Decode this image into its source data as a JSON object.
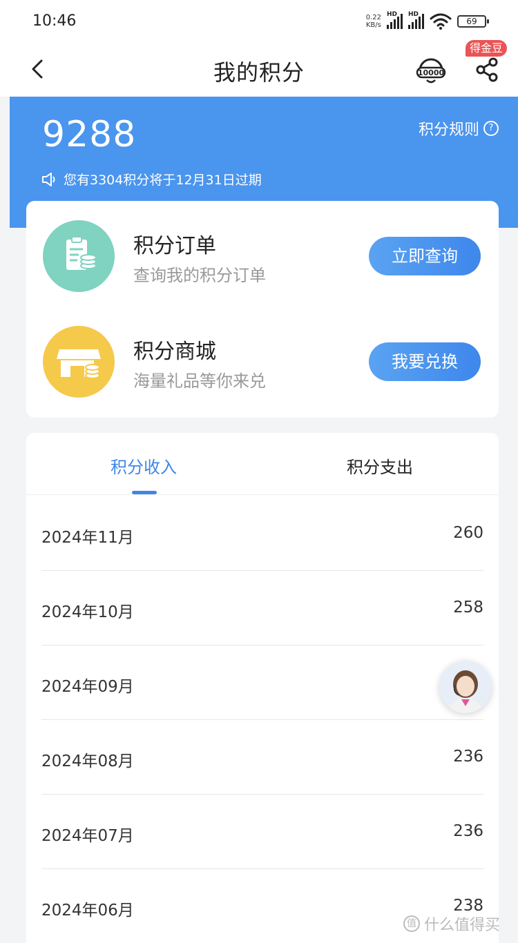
{
  "status_bar": {
    "time": "10:46",
    "net_speed_value": "0.22",
    "net_speed_unit": "KB/s",
    "hd_label_1": "HD",
    "hd_label_2": "HD",
    "battery": "69"
  },
  "header": {
    "title": "我的积分",
    "gold_badge": "得金豆",
    "hotline_label": "10000"
  },
  "banner": {
    "points": "9288",
    "rules_label": "积分规则",
    "expire_notice": "您有3304积分将于12月31日过期"
  },
  "features": [
    {
      "title": "积分订单",
      "subtitle": "查询我的积分订单",
      "button": "立即查询",
      "color": "#7fd3c0"
    },
    {
      "title": "积分商城",
      "subtitle": "海量礼品等你来兑",
      "button": "我要兑换",
      "color": "#f5c94a"
    }
  ],
  "tabs": {
    "income": "积分收入",
    "expense": "积分支出",
    "active": "income"
  },
  "records": [
    {
      "month": "2024年11月",
      "points": "260"
    },
    {
      "month": "2024年10月",
      "points": "258"
    },
    {
      "month": "2024年09月",
      "points": ""
    },
    {
      "month": "2024年08月",
      "points": "236"
    },
    {
      "month": "2024年07月",
      "points": "236"
    },
    {
      "month": "2024年06月",
      "points": "238"
    }
  ],
  "watermark": "什么值得买",
  "colors": {
    "accent": "#3d86e6",
    "banner": "#4a95ee",
    "badge": "#ea5455"
  }
}
